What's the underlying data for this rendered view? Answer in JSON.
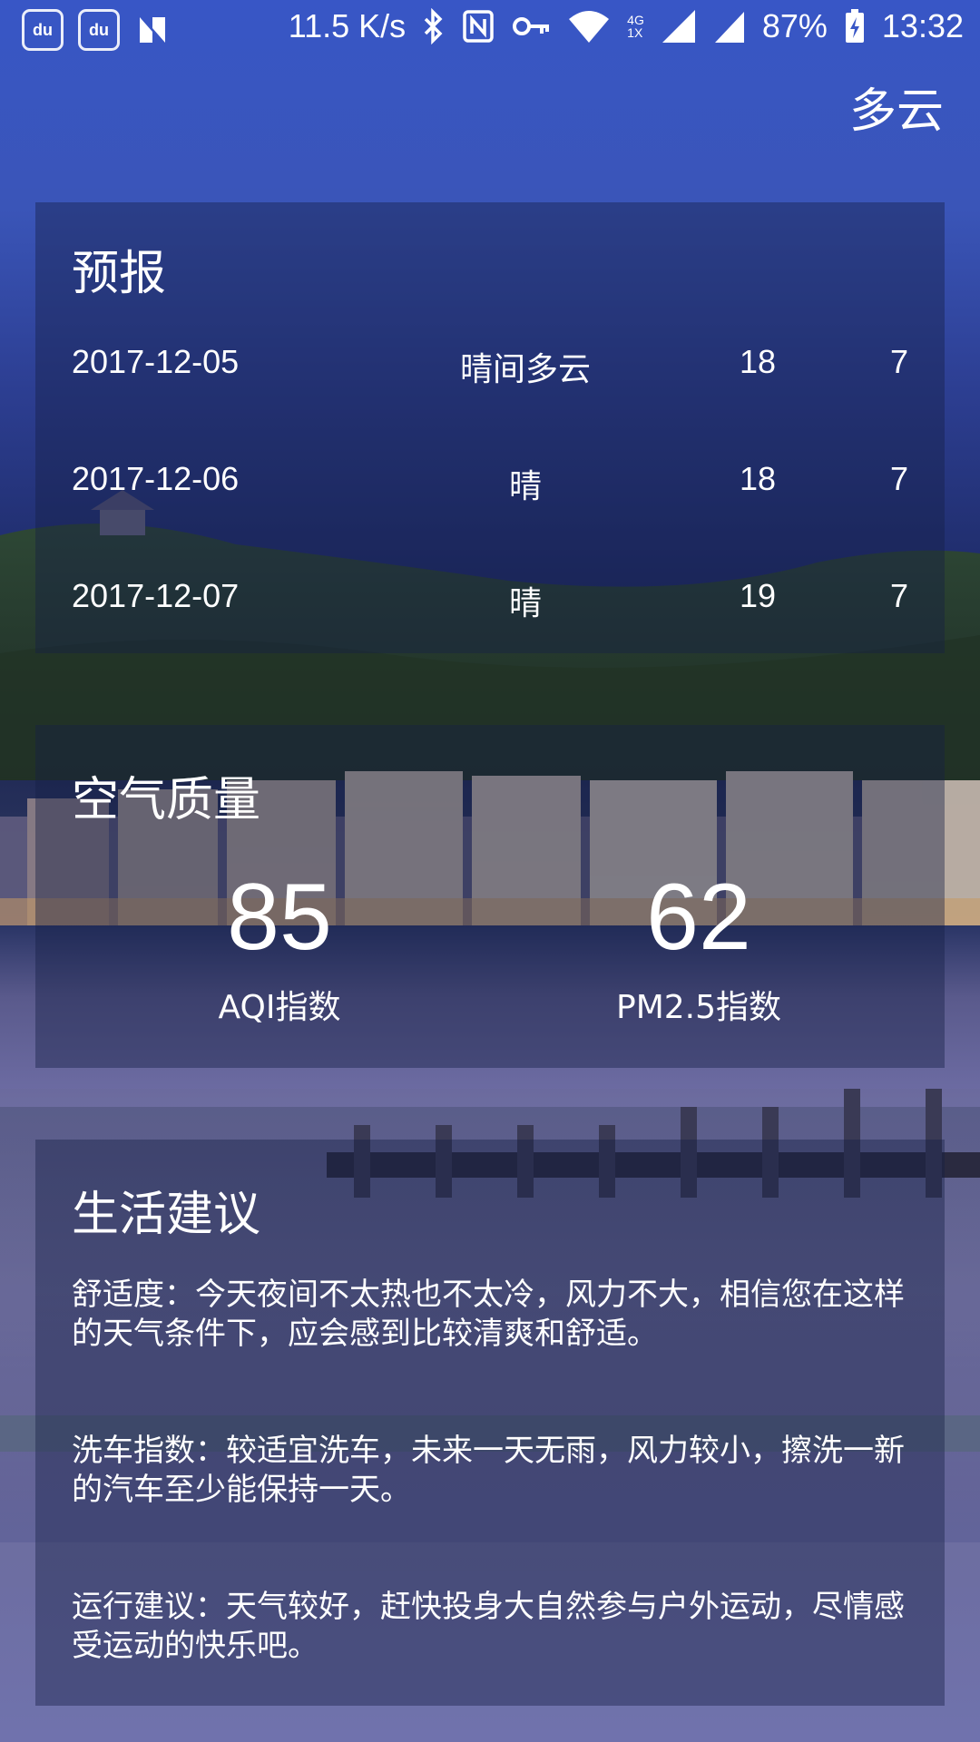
{
  "status_bar": {
    "app_icons": [
      "du",
      "du"
    ],
    "speed": "11.5 K/s",
    "network": "4G\n1X",
    "battery": "87%",
    "time": "13:32"
  },
  "current_weather": "多云",
  "forecast": {
    "title": "预报",
    "rows": [
      {
        "date": "2017-12-05",
        "condition": "晴间多云",
        "max": "18",
        "min": "7"
      },
      {
        "date": "2017-12-06",
        "condition": "晴",
        "max": "18",
        "min": "7"
      },
      {
        "date": "2017-12-07",
        "condition": "晴",
        "max": "19",
        "min": "7"
      }
    ]
  },
  "air_quality": {
    "title": "空气质量",
    "aqi": {
      "value": "85",
      "label": "AQI指数"
    },
    "pm25": {
      "value": "62",
      "label": "PM2.5指数"
    }
  },
  "suggestion": {
    "title": "生活建议",
    "comfort": "舒适度：今天夜间不太热也不太冷，风力不大，相信您在这样的天气条件下，应会感到比较清爽和舒适。",
    "car_wash": "洗车指数：较适宜洗车，未来一天无雨，风力较小，擦洗一新的汽车至少能保持一天。",
    "sport": "运行建议：天气较好，赶快投身大自然参与户外运动，尽情感受运动的快乐吧。"
  },
  "colors": {
    "sky": "#3856c6",
    "card_overlay": "#161e46"
  }
}
